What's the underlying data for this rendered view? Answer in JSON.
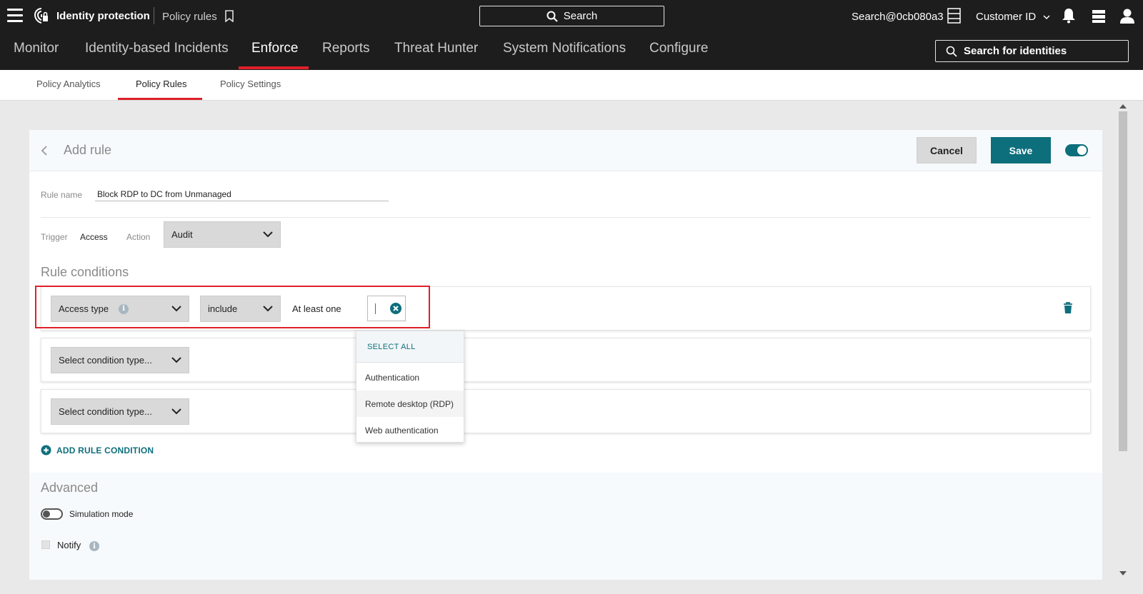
{
  "topbar": {
    "product": "Identity protection",
    "breadcrumb": "Policy rules",
    "search_label": "Search",
    "user_email": "Search@0cb080a3",
    "customer_id": "Customer ID"
  },
  "main_nav": {
    "tabs": [
      {
        "label": "Monitor"
      },
      {
        "label": "Identity-based Incidents"
      },
      {
        "label": "Enforce"
      },
      {
        "label": "Reports"
      },
      {
        "label": "Threat Hunter"
      },
      {
        "label": "System Notifications"
      },
      {
        "label": "Configure"
      }
    ],
    "active": "Enforce",
    "identity_search": "Search for identities"
  },
  "sub_nav": {
    "tabs": [
      {
        "label": "Policy Analytics"
      },
      {
        "label": "Policy Rules"
      },
      {
        "label": "Policy Settings"
      }
    ],
    "active": "Policy Rules"
  },
  "form": {
    "title": "Add rule",
    "cancel_label": "Cancel",
    "save_label": "Save",
    "enabled": true,
    "rule_name_label": "Rule name",
    "rule_name_value": "Block RDP to DC from Unmanaged",
    "trigger_label": "Trigger",
    "trigger_value": "Access",
    "action_label": "Action",
    "action_value": "Audit",
    "conditions_title": "Rule conditions",
    "conditions": [
      {
        "type": "Access type",
        "operator": "include",
        "quantifier": "At least one"
      },
      {
        "type": "Select condition type..."
      },
      {
        "type": "Select condition type..."
      }
    ],
    "dropdown": {
      "select_all": "SELECT ALL",
      "options": [
        "Authentication",
        "Remote desktop (RDP)",
        "Web authentication"
      ],
      "hovered": "Remote desktop (RDP)"
    },
    "add_condition_label": "ADD RULE CONDITION",
    "advanced_title": "Advanced",
    "simulation_label": "Simulation mode",
    "simulation_on": false,
    "notify_label": "Notify",
    "notify_checked": false
  },
  "colors": {
    "accent": "#0d6f7c",
    "active_tab": "#e0202a",
    "highlight": "#e0202a",
    "topbar_bg": "#1d1d1d"
  }
}
